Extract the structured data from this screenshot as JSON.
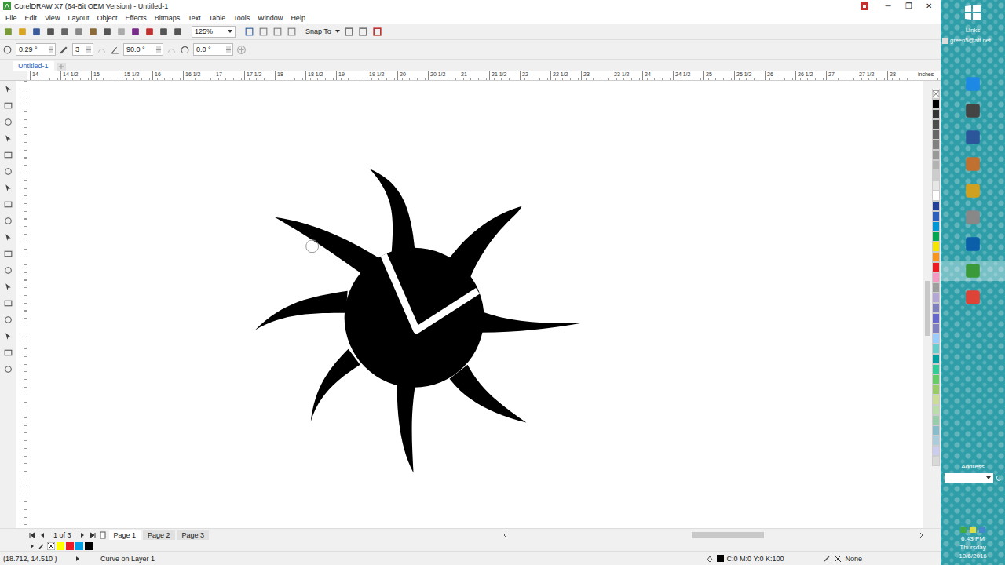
{
  "window": {
    "title": "CorelDRAW X7 (64-Bit OEM Version) - Untitled-1",
    "controls": [
      "─",
      "❐",
      "✕"
    ]
  },
  "menu": [
    "File",
    "Edit",
    "View",
    "Layout",
    "Object",
    "Effects",
    "Bitmaps",
    "Text",
    "Table",
    "Tools",
    "Window",
    "Help"
  ],
  "toolbar": {
    "zoom": "125%",
    "snap": "Snap To"
  },
  "property_bar": {
    "outline_width": "0.29 °",
    "nodes": "3",
    "angle": "90.0 °",
    "rotation": "0.0 °"
  },
  "document_tabs": [
    {
      "label": "Untitled-1",
      "selected": true
    }
  ],
  "ruler": {
    "marks": [
      "14",
      "14 1/2",
      "15",
      "15 1/2",
      "16",
      "16 1/2",
      "17",
      "17 1/2",
      "18",
      "18 1/2",
      "19",
      "19 1/2",
      "20",
      "20 1/2",
      "21",
      "21 1/2",
      "22",
      "22 1/2",
      "23",
      "23 1/2",
      "24",
      "24 1/2",
      "25",
      "25 1/2",
      "26",
      "26 1/2",
      "27",
      "27 1/2",
      "28"
    ],
    "unit": "inches"
  },
  "palette": [
    {
      "color": "#000000"
    },
    {
      "color": "#333333"
    },
    {
      "color": "#4d4d4d"
    },
    {
      "color": "#666666"
    },
    {
      "color": "#808080"
    },
    {
      "color": "#999999"
    },
    {
      "color": "#b3b3b3"
    },
    {
      "color": "#cccccc"
    },
    {
      "color": "#e6e6e6"
    },
    {
      "color": "#ffffff"
    },
    {
      "color": "#1f3f99"
    },
    {
      "color": "#2e5fbf"
    },
    {
      "color": "#0096d6"
    },
    {
      "color": "#00a651"
    },
    {
      "color": "#f5e400"
    },
    {
      "color": "#f7941d"
    },
    {
      "color": "#ed1c24"
    },
    {
      "color": "#f49ac2"
    },
    {
      "color": "#9e9e9e"
    },
    {
      "color": "#b4a7d6"
    },
    {
      "color": "#7f7fbf"
    },
    {
      "color": "#6666cc"
    },
    {
      "color": "#8080c0"
    },
    {
      "color": "#99ccff"
    },
    {
      "color": "#66cccc"
    },
    {
      "color": "#00a0a0"
    },
    {
      "color": "#33cc99"
    },
    {
      "color": "#66cc66"
    },
    {
      "color": "#99cc66"
    },
    {
      "color": "#ccdd99"
    },
    {
      "color": "#bbddaa"
    },
    {
      "color": "#99ccaa"
    },
    {
      "color": "#88bbcc"
    },
    {
      "color": "#aaccdd"
    },
    {
      "color": "#ccccee"
    },
    {
      "color": "#d9d9d9"
    }
  ],
  "document_palette": [
    {
      "color": "#ffff00"
    },
    {
      "color": "#ed1c24"
    },
    {
      "color": "#00a0e9"
    },
    {
      "color": "#000000"
    }
  ],
  "page_nav": {
    "count": "1 of 3",
    "pages": [
      {
        "label": "Page 1",
        "selected": true
      },
      {
        "label": "Page 2",
        "selected": false
      },
      {
        "label": "Page 3",
        "selected": false
      }
    ]
  },
  "status_bar": {
    "coordinates": "(18.712, 14.510 )",
    "object": "Curve on Layer 1",
    "fill": "C:0 M:0 Y:0 K:100",
    "outline": "None"
  },
  "taskbar": {
    "links": "Links",
    "account": "green5@att.net",
    "address_label": "Address",
    "time": "6:43 PM",
    "day": "Thursday",
    "date": "10/6/2016"
  }
}
